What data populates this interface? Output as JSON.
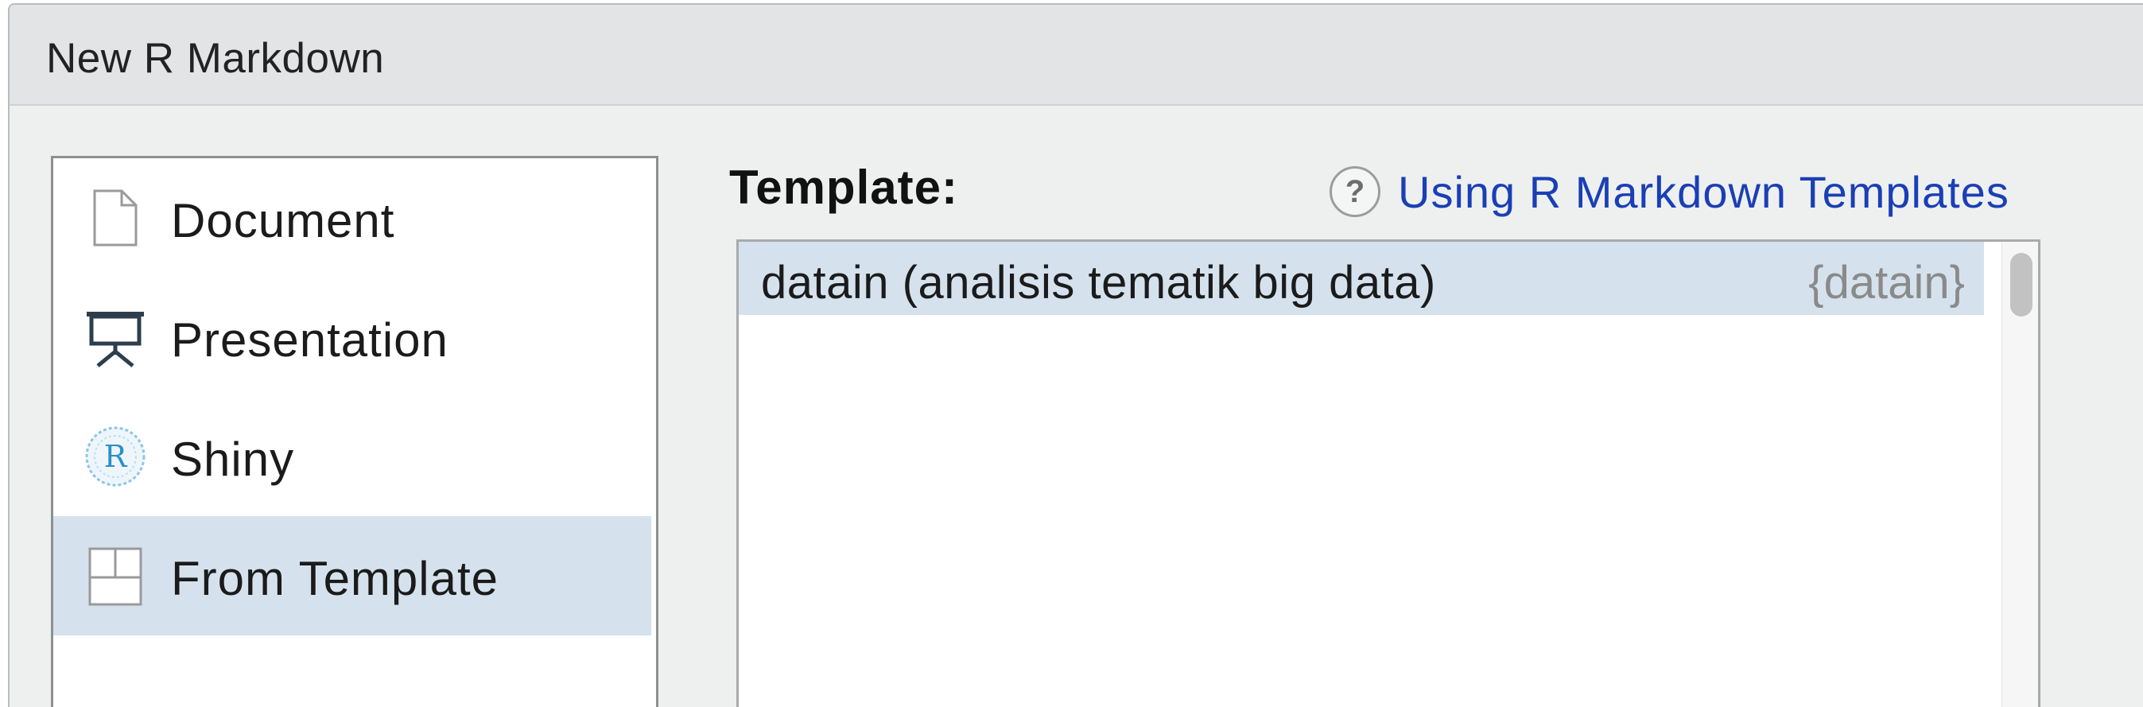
{
  "window": {
    "title": "New R Markdown"
  },
  "sidebar": {
    "items": [
      {
        "label": "Document",
        "icon": "document-icon",
        "selected": false
      },
      {
        "label": "Presentation",
        "icon": "presentation-icon",
        "selected": false
      },
      {
        "label": "Shiny",
        "icon": "shiny-r-icon",
        "selected": false
      },
      {
        "label": "From Template",
        "icon": "template-icon",
        "selected": true
      }
    ]
  },
  "template_panel": {
    "label": "Template:",
    "help_icon": "question-mark-icon",
    "help_link": "Using R Markdown Templates",
    "templates": [
      {
        "name": "datain (analisis tematik big data)",
        "package": "{datain}",
        "selected": true
      }
    ]
  },
  "colors": {
    "selection": "#d5e2ee",
    "link": "#1a3fb5",
    "titlebar": "#e2e4e6",
    "dialog_bg": "#eef0f0"
  }
}
